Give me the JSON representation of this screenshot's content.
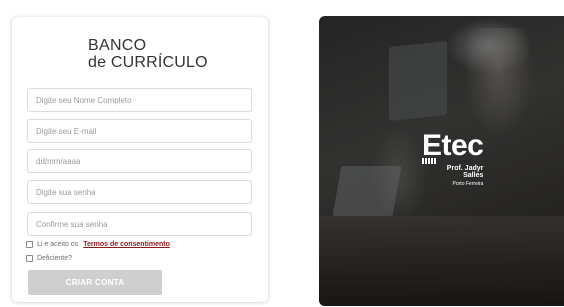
{
  "form": {
    "title_line1": "BANCO",
    "title_line2": "de CURRÍCULO",
    "fields": [
      {
        "placeholder": "Digite seu Nome Completo",
        "value": ""
      },
      {
        "placeholder": "Digite seu E-mail",
        "value": ""
      },
      {
        "placeholder": "dd/mm/aaaa",
        "value": ""
      },
      {
        "placeholder": "Digite sua senha",
        "value": ""
      },
      {
        "placeholder": "Confirme sua senha",
        "value": ""
      }
    ],
    "consent_text": "Li e aceito os",
    "consent_link": "Termos de consentimento",
    "disabled_label": "Deficiente?",
    "submit_label": "CRIAR CONTA"
  },
  "logo": {
    "name": "Etec",
    "line1": "Prof. Jadyr",
    "line2": "Salles",
    "city": "Porto Ferreira"
  },
  "colors": {
    "link": "#8b1a1a",
    "submit_bg": "#cfcfcf",
    "title": "#333333"
  }
}
